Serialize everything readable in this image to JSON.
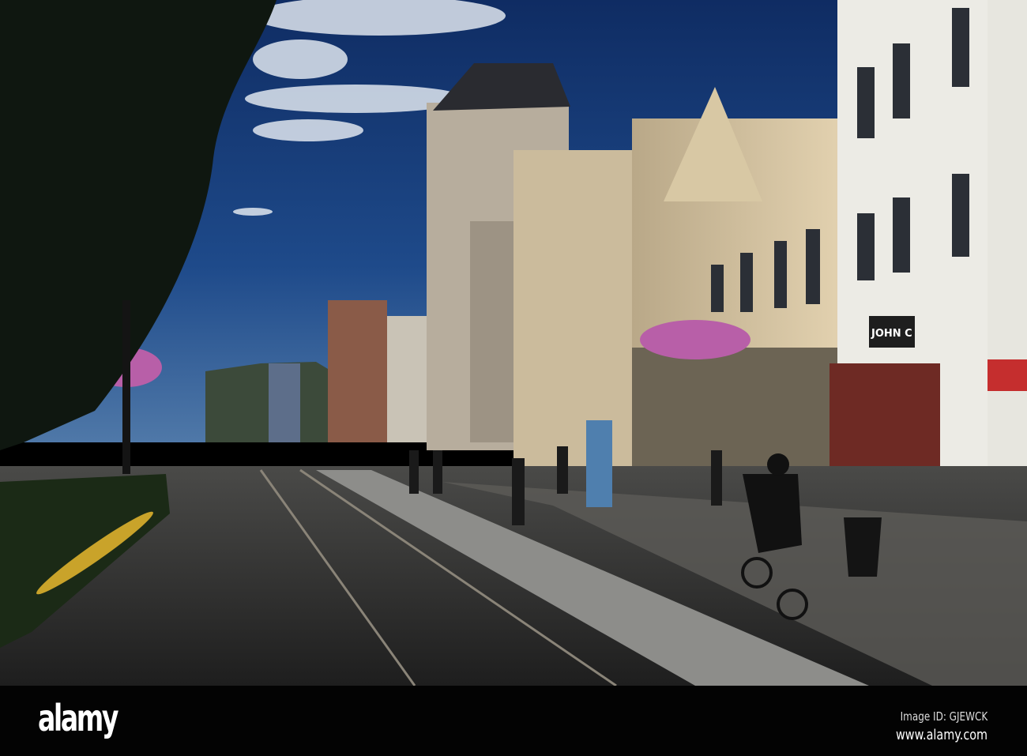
{
  "photo": {
    "description_icon": "street-photo",
    "sky_color": "#1b3f7a",
    "shop_sign": "JOHN C"
  },
  "footer": {
    "logo": "alamy",
    "image_id": "Image ID: GJEWCK",
    "url": "www.alamy.com"
  }
}
